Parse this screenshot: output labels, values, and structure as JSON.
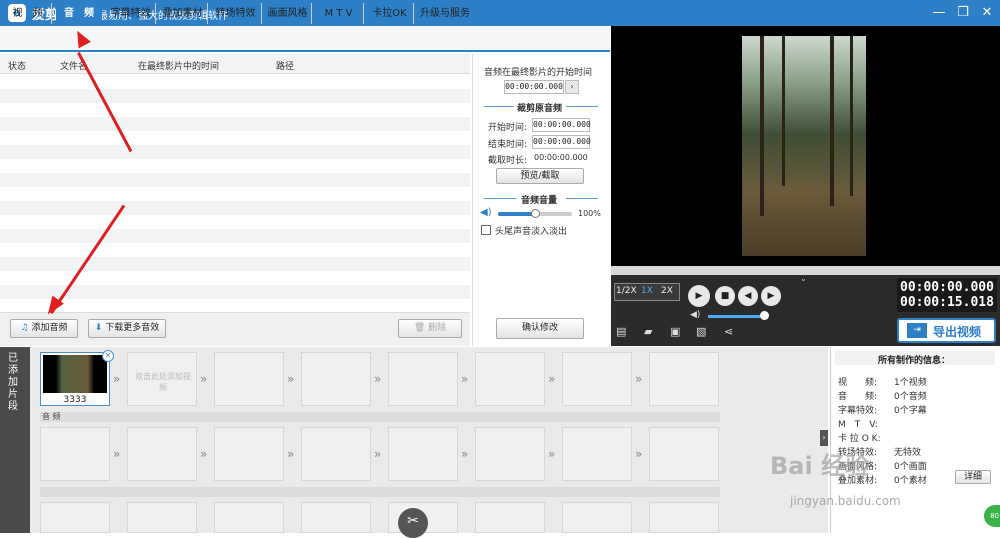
{
  "app": {
    "title": "爱剪辑",
    "slogan": "最易用、强大的视频剪辑软件",
    "logo_text": "e"
  },
  "window_controls": {
    "minimize": "—",
    "maximize": "❐",
    "close": "✕"
  },
  "tabs": [
    {
      "label": "视　频",
      "active": false
    },
    {
      "label": "音　频",
      "active": true
    },
    {
      "label": "字幕特效",
      "active": false
    },
    {
      "label": "叠加素材",
      "active": false
    },
    {
      "label": "转场特效",
      "active": false
    },
    {
      "label": "画面风格",
      "active": false
    },
    {
      "label": "M T V",
      "active": false
    },
    {
      "label": "卡拉OK",
      "active": false
    },
    {
      "label": "升级与服务",
      "active": false
    }
  ],
  "list": {
    "columns": [
      "状态",
      "文件名",
      "在最终影片中的时间",
      "路径"
    ]
  },
  "list_toolbar": {
    "add_audio": "添加音频",
    "download_more": "下载更多音效",
    "delete": "删除"
  },
  "audio_panel": {
    "start_title": "音频在最终影片的开始时间",
    "start_time": "00:00:00.000",
    "crop_title": "裁剪原音频",
    "start_label": "开始时间:",
    "start_value": "00:00:00.000",
    "end_label": "结束时间:",
    "end_value": "00:00:00.000",
    "duration_label": "截取时长:",
    "duration_value": "00:00:00.000",
    "preview_button": "预览/截取",
    "volume_title": "音频音量",
    "volume_value": "100%",
    "volume_level": 0.5,
    "fade_label": "头尾声音淡入淡出",
    "confirm_button": "确认修改"
  },
  "player": {
    "speed_half": "1/2X",
    "speed_1x": "1X",
    "speed_2x": "2X",
    "current_time": "00:00:00.000",
    "total_time": "00:00:15.018",
    "export_button": "导出视频"
  },
  "timeline": {
    "side_label": "已添加片段",
    "clip_name": "3333",
    "placeholder": "双击此处添加视频",
    "audio_label": "音 频"
  },
  "info": {
    "title": "所有制作的信息：",
    "rows": [
      {
        "key": "视　　频:",
        "value": "1个视频"
      },
      {
        "key": "音　　频:",
        "value": "0个音频"
      },
      {
        "key": "字幕特效:",
        "value": "0个字幕"
      },
      {
        "key": "M　T　V:",
        "value": ""
      },
      {
        "key": "卡 拉 O K:",
        "value": ""
      },
      {
        "key": "转场特效:",
        "value": "无特效"
      },
      {
        "key": "画面风格:",
        "value": "0个画面"
      },
      {
        "key": "叠加素材:",
        "value": "0个素材"
      }
    ],
    "detail_button": "详细"
  },
  "watermark": {
    "line1": "Bai 经验",
    "line2": "jingyan.baidu.com"
  },
  "corner_badge": "80"
}
